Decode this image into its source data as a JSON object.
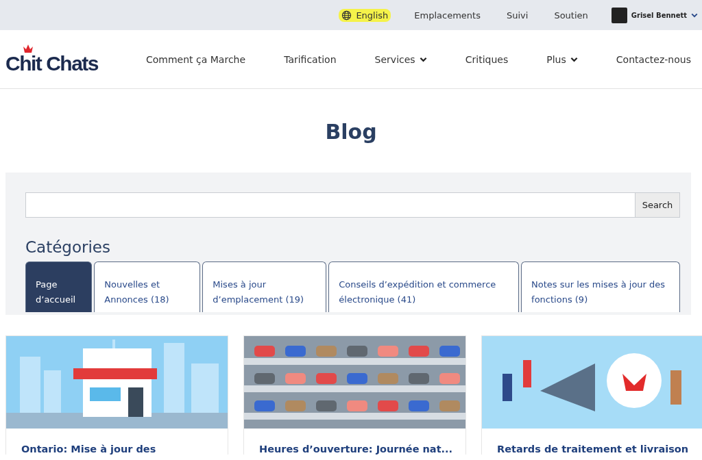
{
  "top_bar": {
    "links": [
      {
        "label": "English",
        "kind": "language",
        "highlighted": true
      },
      {
        "label": "Emplacements",
        "kind": "link",
        "highlighted": false
      },
      {
        "label": "Suivi",
        "kind": "link",
        "highlighted": false
      },
      {
        "label": "Soutien",
        "kind": "link",
        "highlighted": false
      }
    ],
    "user": {
      "name": "Grisel Bennett"
    }
  },
  "header": {
    "logo": "Chit Chats",
    "nav": [
      {
        "label": "Comment ça Marche",
        "dropdown": false
      },
      {
        "label": "Tarification",
        "dropdown": false
      },
      {
        "label": "Services",
        "dropdown": true
      },
      {
        "label": "Critiques",
        "dropdown": false
      },
      {
        "label": "Plus",
        "dropdown": true
      },
      {
        "label": "Contactez-nous",
        "dropdown": false
      }
    ]
  },
  "page_title": "Blog",
  "search": {
    "button": "Search"
  },
  "categories": {
    "title": "Catégories",
    "tabs": [
      {
        "label": "Page d’accueil",
        "selected": true
      },
      {
        "label": "Nouvelles et Annonces (18)",
        "selected": false
      },
      {
        "label": "Mises à jour d’emplacement (19)",
        "selected": false
      },
      {
        "label": "Conseils d’expédition et commerce électronique (41)",
        "selected": false
      },
      {
        "label": "Notes sur les mises à jour des fonctions (9)",
        "selected": false
      }
    ]
  },
  "posts": [
    {
      "title": "Ontario: Mise à jour des",
      "kind": "storefront"
    },
    {
      "title": "Heures d’ouverture: Journée nat...",
      "kind": "shoes"
    },
    {
      "title": "Retards de traitement et livraison",
      "kind": "megaphone"
    }
  ]
}
